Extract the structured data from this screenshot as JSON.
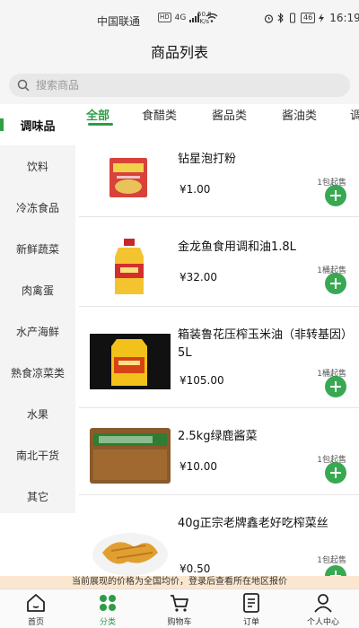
{
  "status_bar": {
    "carrier": "中国联通",
    "hd": "HD",
    "network": "4G",
    "speed_value": "50.8",
    "speed_unit": "K/s",
    "battery": "46",
    "time": "16:19"
  },
  "header": {
    "title": "商品列表"
  },
  "search": {
    "placeholder": "搜索商品"
  },
  "sidebar": {
    "items": [
      {
        "label": "调味品",
        "active": true
      },
      {
        "label": "饮料"
      },
      {
        "label": "冷冻食品"
      },
      {
        "label": "新鲜蔬菜"
      },
      {
        "label": "肉禽蛋"
      },
      {
        "label": "水产海鲜"
      },
      {
        "label": "熟食凉菜类"
      },
      {
        "label": "水果"
      },
      {
        "label": "南北干货"
      },
      {
        "label": "其它"
      }
    ]
  },
  "tabs": [
    {
      "label": "全部",
      "active": true
    },
    {
      "label": "食醋类"
    },
    {
      "label": "酱品类"
    },
    {
      "label": "酱油类"
    },
    {
      "label": "调"
    }
  ],
  "products": [
    {
      "name": "钻星泡打粉",
      "price": "¥1.00",
      "unit": "1包起售"
    },
    {
      "name": "金龙鱼食用调和油1.8L",
      "price": "¥32.00",
      "unit": "1桶起售"
    },
    {
      "name": "箱装鲁花压榨玉米油（非转基因）5L",
      "price": "¥105.00",
      "unit": "1桶起售"
    },
    {
      "name": "2.5kg绿鹿酱菜",
      "price": "¥10.00",
      "unit": "1包起售"
    },
    {
      "name": "40g正宗老牌鑫老好吃榨菜丝",
      "price": "¥0.50",
      "unit": "1包起售"
    }
  ],
  "notice": "当前展现的价格为全国均价，登录后查看所在地区报价",
  "bottom_nav": [
    {
      "label": "首页",
      "icon": "home-icon"
    },
    {
      "label": "分类",
      "icon": "category-icon",
      "active": true
    },
    {
      "label": "购物车",
      "icon": "cart-icon"
    },
    {
      "label": "订单",
      "icon": "order-icon"
    },
    {
      "label": "个人中心",
      "icon": "user-icon"
    }
  ],
  "colors": {
    "accent": "#2e9c46",
    "add_button": "#39a853",
    "notice_bg": "#fbe7cf"
  }
}
